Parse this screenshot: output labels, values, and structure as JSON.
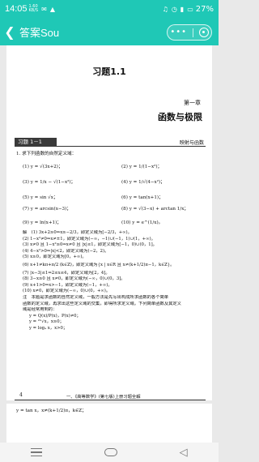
{
  "status_bar": {
    "time": "14:05",
    "network_speed": "1.60",
    "network_unit": "KB/S",
    "battery": "27%"
  },
  "title_bar": {
    "back_icon": "chevron-left-icon",
    "title": "答案Sou",
    "more_icon": "more-dots-icon",
    "close_icon": "target-icon"
  },
  "document": {
    "section_title": "习题1.1",
    "chapter_label": "第一章",
    "chapter_name": "函数与极限",
    "exercise_tag": "习题 1－1",
    "exercise_topic": "映射与函数",
    "question_intro": "1. 求下列函数的自然定义域：",
    "items": [
      {
        "left": "(1) y = √(3x+2)；",
        "right": "(2) y = 1/(1−x²)；"
      },
      {
        "left": "(3) y = 1/x − √(1−x²)；",
        "right": "(4) y = 1/√(4−x²)；"
      },
      {
        "left": "(5) y = sin √x；",
        "right": "(6) y = tan(x+1)；"
      },
      {
        "left": "(7) y = arcsin(x−3)；",
        "right": "(8) y = √(3−x) + arctan 1/x；"
      },
      {
        "left": "(9) y = ln(x+1)；",
        "right": "(10) y = e^(1/x)。"
      }
    ],
    "solution": [
      "解　(1) 3x+2≥0⇒x≥−2/3，即定义域为[−2/3，+∞)。",
      "(2) 1−x²≠0⇒x≠±1，即定义域为(−∞，−1)∪(−1，1)∪(1，+∞)。",
      "(3) x≠0 且 1−x²≥0⇒x≠0 且 |x|≤1，即定义域为[−1，0)∪(0，1]。",
      "(4) 4−x²>0⇒|x|<2，即定义域为(−2，2)。",
      "(5) x≥0，即定义域为[0，+∞)。",
      "(6) x+1≠kπ+π/2 (k∈Z)，即定义域为{x | x∈R 且 x≠(k+1/2)π−1，k∈Z}。",
      "(7) |x−3|≤1⇒2≤x≤4，即定义域为[2，4]。",
      "(8) 3−x≥0 且 x≠0，即定义域为(−∞，0)∪(0，3]。",
      "(9) x+1>0⇒x>−1，即定义域为(−1，+∞)。",
      "(10) x≠0，即定义域为(−∞，0)∪(0，+∞)。",
      "注　本题是求函数的自然定义域，一般方法是先写出构成所求函数的各个简单",
      "函数的定义域，再求出这些定义域的交集，即得所求定义域。下列简单函数及其定义",
      "域是经常用到的：",
      "y = Q(x)/P(x)，P(x)≠0；",
      "y = ²ⁿ√x，x≥0；",
      "y = logₐ x，x>0；"
    ],
    "page_number": "4",
    "footer_text": "一、《高等数学》(第七版)上册习题全解"
  },
  "next_page": {
    "line": "y = tan x，x≠(k+1/2)π，k∈Z；"
  },
  "nav_bar": {
    "menu_icon": "menu-icon",
    "home_icon": "home-icon",
    "back_icon": "back-triangle-icon"
  }
}
